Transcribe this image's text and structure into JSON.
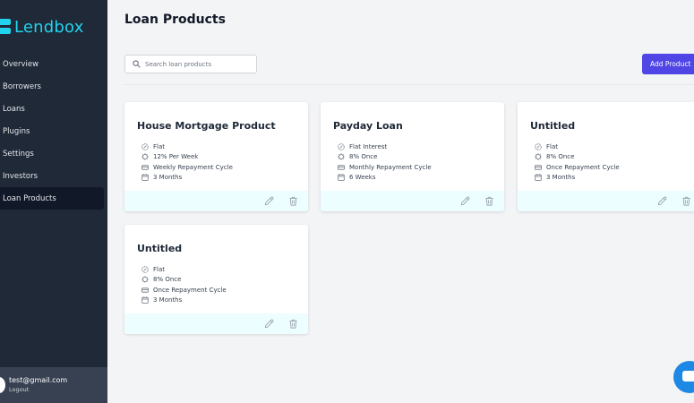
{
  "app": {
    "name": "Lendbox"
  },
  "sidebar": {
    "items": [
      {
        "label": "Overview"
      },
      {
        "label": "Borrowers"
      },
      {
        "label": "Loans"
      },
      {
        "label": "Plugins"
      },
      {
        "label": "Settings"
      },
      {
        "label": "Investors"
      },
      {
        "label": "Loan Products",
        "active": true
      }
    ]
  },
  "user": {
    "email": "test@gmail.com",
    "logout_label": "Logout"
  },
  "header": {
    "title": "Loan Products"
  },
  "search": {
    "placeholder": "Search loan products",
    "value": ""
  },
  "toolbar": {
    "add_label": "Add Product"
  },
  "products": [
    {
      "title": "House Mortgage Product",
      "interest_type": "Flat",
      "rate": "12% Per Week",
      "repayment": "Weekly Repayment Cycle",
      "duration": "3 Months"
    },
    {
      "title": "Payday Loan",
      "interest_type": "Flat Interest",
      "rate": "8% Once",
      "repayment": "Monthly Repayment Cycle",
      "duration": "6 Weeks"
    },
    {
      "title": "Untitled",
      "interest_type": "Flat",
      "rate": "8% Once",
      "repayment": "Once Repayment Cycle",
      "duration": "3 Months"
    },
    {
      "title": "Untitled",
      "interest_type": "Flat",
      "rate": "8% Once",
      "repayment": "Once Repayment Cycle",
      "duration": "3 Months"
    }
  ],
  "colors": {
    "sidebar_bg": "#1f2937",
    "brand": "#22d3ee",
    "accent": "#4f46e5",
    "card_footer": "#ecfeff",
    "chat": "#1e88e5"
  },
  "icons": {
    "interest_type": "percent-badge-icon",
    "rate": "gear-percent-icon",
    "repayment": "cash-icon",
    "duration": "calendar-icon",
    "edit": "pencil-icon",
    "delete": "trash-icon",
    "search": "search-icon",
    "chat": "chat-bubble-icon"
  }
}
